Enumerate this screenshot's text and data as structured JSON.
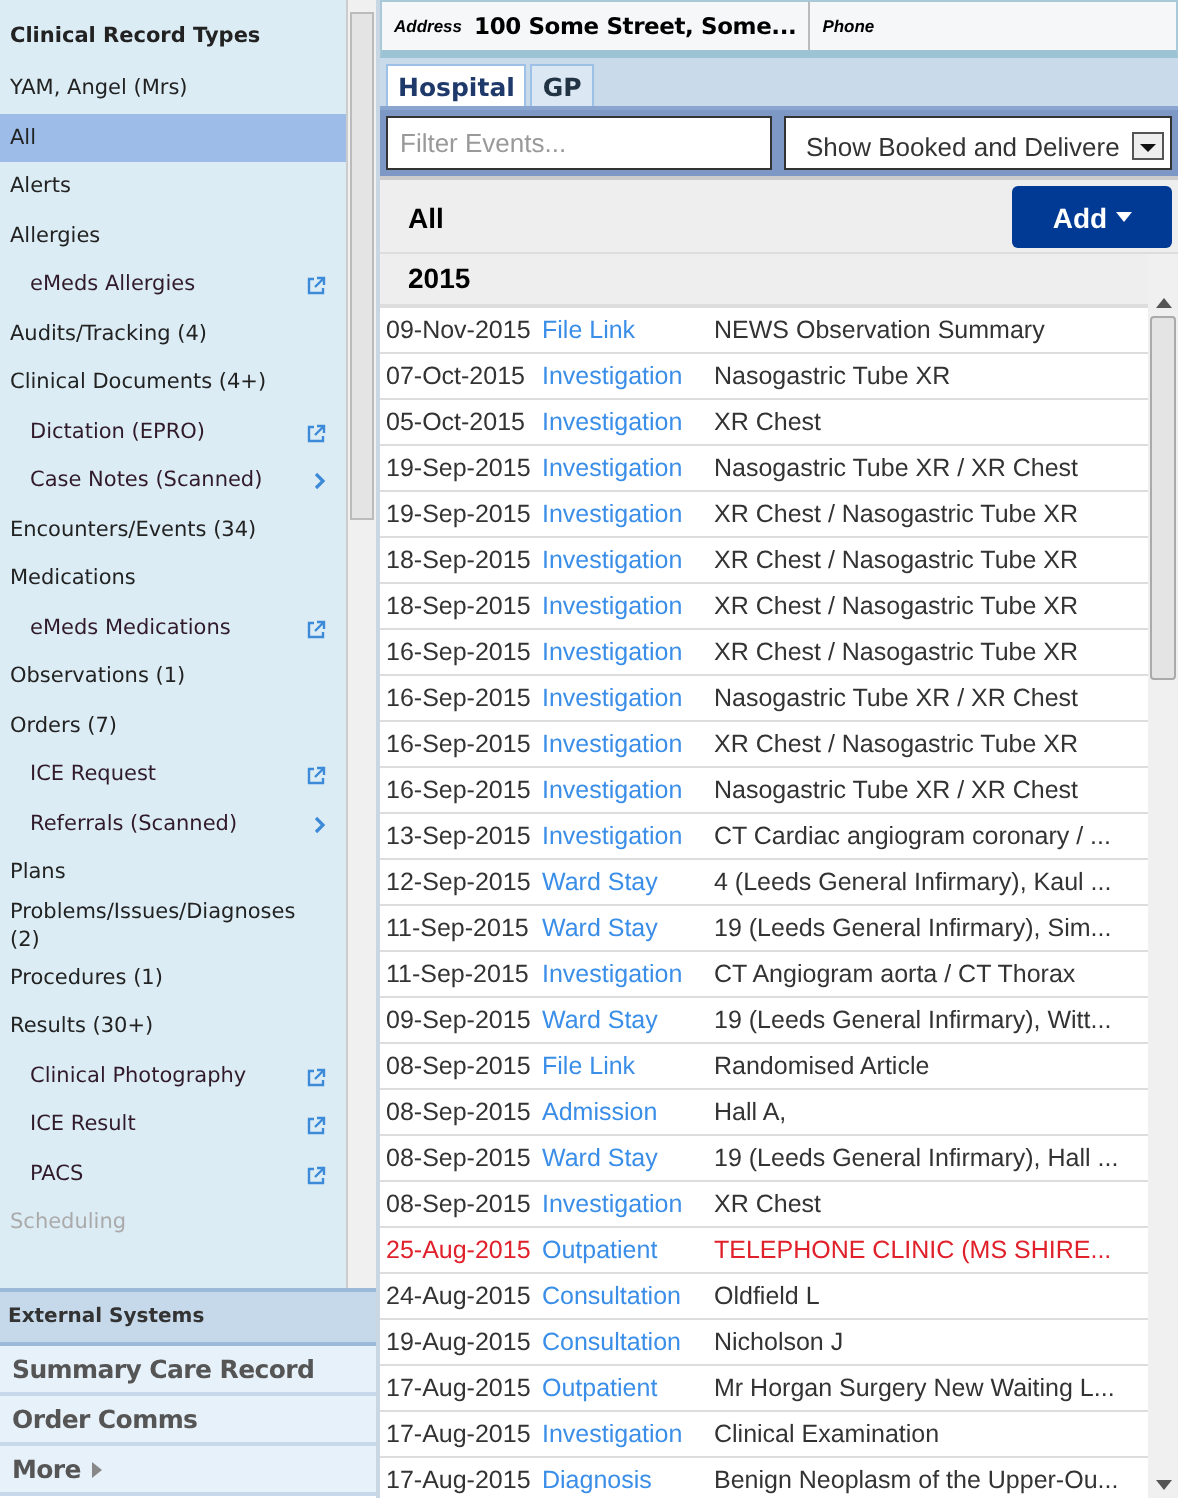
{
  "sidebar": {
    "title": "Clinical Record Types",
    "items": [
      {
        "label": "YAM, Angel (Mrs)",
        "kind": "item",
        "selected": false,
        "disabled": false
      },
      {
        "label": "All",
        "kind": "item",
        "selected": true,
        "disabled": false
      },
      {
        "label": "Alerts",
        "kind": "item",
        "selected": false,
        "disabled": false
      },
      {
        "label": "Allergies",
        "kind": "item",
        "selected": false,
        "disabled": false
      },
      {
        "label": "eMeds Allergies",
        "kind": "external",
        "selected": false,
        "disabled": false
      },
      {
        "label": "Audits/Tracking (4)",
        "kind": "item",
        "selected": false,
        "disabled": false
      },
      {
        "label": "Clinical Documents (4+)",
        "kind": "item",
        "selected": false,
        "disabled": false
      },
      {
        "label": "Dictation (EPRO)",
        "kind": "external",
        "selected": false,
        "disabled": false
      },
      {
        "label": "Case Notes (Scanned)",
        "kind": "submenu",
        "selected": false,
        "disabled": false
      },
      {
        "label": "Encounters/Events (34)",
        "kind": "item",
        "selected": false,
        "disabled": false
      },
      {
        "label": "Medications",
        "kind": "item",
        "selected": false,
        "disabled": false
      },
      {
        "label": "eMeds Medications",
        "kind": "external",
        "selected": false,
        "disabled": false
      },
      {
        "label": "Observations (1)",
        "kind": "item",
        "selected": false,
        "disabled": false
      },
      {
        "label": "Orders (7)",
        "kind": "item",
        "selected": false,
        "disabled": false
      },
      {
        "label": "ICE Request",
        "kind": "external",
        "selected": false,
        "disabled": false
      },
      {
        "label": "Referrals (Scanned)",
        "kind": "submenu",
        "selected": false,
        "disabled": false
      },
      {
        "label": "Plans",
        "kind": "item",
        "selected": false,
        "disabled": false
      },
      {
        "label": "Problems/Issues/Diagnoses (2)",
        "kind": "item",
        "selected": false,
        "disabled": false
      },
      {
        "label": "Procedures (1)",
        "kind": "item",
        "selected": false,
        "disabled": false
      },
      {
        "label": "Results (30+)",
        "kind": "item",
        "selected": false,
        "disabled": false
      },
      {
        "label": "Clinical Photography",
        "kind": "external",
        "selected": false,
        "disabled": false
      },
      {
        "label": "ICE Result",
        "kind": "external",
        "selected": false,
        "disabled": false
      },
      {
        "label": "PACS",
        "kind": "external",
        "selected": false,
        "disabled": false
      },
      {
        "label": "Scheduling",
        "kind": "item",
        "selected": false,
        "disabled": true
      }
    ]
  },
  "external_systems": {
    "title": "External Systems",
    "links": [
      "Summary Care Record",
      "Order Comms",
      "More"
    ]
  },
  "header": {
    "address_label": "Address",
    "address": "100 Some Street, Some...",
    "phone_label": "Phone"
  },
  "tabs": [
    {
      "label": "Hospital",
      "selected": true
    },
    {
      "label": "GP",
      "selected": false
    }
  ],
  "filter": {
    "placeholder": "Filter Events...",
    "dropdown": "Show Booked and Delivere"
  },
  "list": {
    "heading": "All",
    "add_button": "Add",
    "year": "2015",
    "rows": [
      {
        "date": "09-Nov-2015",
        "type": "File Link",
        "description": "NEWS Observation Summary",
        "alert": false
      },
      {
        "date": "07-Oct-2015",
        "type": "Investigation",
        "description": "Nasogastric Tube XR",
        "alert": false
      },
      {
        "date": "05-Oct-2015",
        "type": "Investigation",
        "description": "XR Chest",
        "alert": false
      },
      {
        "date": "19-Sep-2015",
        "type": "Investigation",
        "description": "Nasogastric Tube XR / XR Chest",
        "alert": false
      },
      {
        "date": "19-Sep-2015",
        "type": "Investigation",
        "description": "XR Chest / Nasogastric Tube XR",
        "alert": false
      },
      {
        "date": "18-Sep-2015",
        "type": "Investigation",
        "description": "XR Chest / Nasogastric Tube XR",
        "alert": false
      },
      {
        "date": "18-Sep-2015",
        "type": "Investigation",
        "description": "XR Chest / Nasogastric Tube XR",
        "alert": false
      },
      {
        "date": "16-Sep-2015",
        "type": "Investigation",
        "description": "XR Chest / Nasogastric Tube XR",
        "alert": false
      },
      {
        "date": "16-Sep-2015",
        "type": "Investigation",
        "description": "Nasogastric Tube XR / XR Chest",
        "alert": false
      },
      {
        "date": "16-Sep-2015",
        "type": "Investigation",
        "description": "XR Chest / Nasogastric Tube XR",
        "alert": false
      },
      {
        "date": "16-Sep-2015",
        "type": "Investigation",
        "description": "Nasogastric Tube XR / XR Chest",
        "alert": false
      },
      {
        "date": "13-Sep-2015",
        "type": "Investigation",
        "description": "CT Cardiac angiogram coronary / ...",
        "alert": false
      },
      {
        "date": "12-Sep-2015",
        "type": "Ward Stay",
        "description": "4 (Leeds General Infirmary), Kaul ...",
        "alert": false
      },
      {
        "date": "11-Sep-2015",
        "type": "Ward Stay",
        "description": "19 (Leeds General Infirmary), Sim...",
        "alert": false
      },
      {
        "date": "11-Sep-2015",
        "type": "Investigation",
        "description": "CT Angiogram aorta / CT Thorax",
        "alert": false
      },
      {
        "date": "09-Sep-2015",
        "type": "Ward Stay",
        "description": "19 (Leeds General Infirmary), Witt...",
        "alert": false
      },
      {
        "date": "08-Sep-2015",
        "type": "File Link",
        "description": "Randomised Article",
        "alert": false
      },
      {
        "date": "08-Sep-2015",
        "type": "Admission",
        "description": "Hall A,",
        "alert": false
      },
      {
        "date": "08-Sep-2015",
        "type": "Ward Stay",
        "description": "19 (Leeds General Infirmary), Hall ...",
        "alert": false
      },
      {
        "date": "08-Sep-2015",
        "type": "Investigation",
        "description": "XR Chest",
        "alert": false
      },
      {
        "date": "25-Aug-2015",
        "type": "Outpatient",
        "description": "TELEPHONE CLINIC (MS SHIRE...",
        "alert": true
      },
      {
        "date": "24-Aug-2015",
        "type": "Consultation",
        "description": "Oldfield L",
        "alert": false
      },
      {
        "date": "19-Aug-2015",
        "type": "Consultation",
        "description": "Nicholson J",
        "alert": false
      },
      {
        "date": "17-Aug-2015",
        "type": "Outpatient",
        "description": "Mr Horgan Surgery New Waiting L...",
        "alert": false
      },
      {
        "date": "17-Aug-2015",
        "type": "Investigation",
        "description": "Clinical Examination",
        "alert": false
      },
      {
        "date": "17-Aug-2015",
        "type": "Diagnosis",
        "description": "Benign Neoplasm of the Upper-Ou...",
        "alert": false
      }
    ]
  }
}
